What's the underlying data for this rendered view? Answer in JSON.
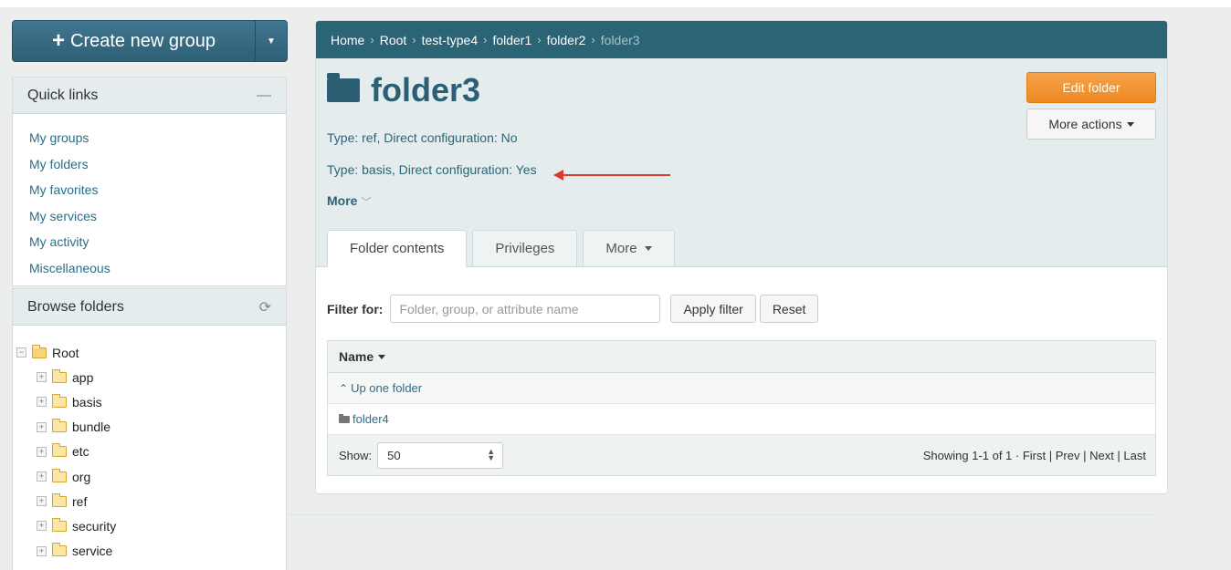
{
  "sidebar": {
    "create_button": {
      "label": "Create new group"
    },
    "quick_links": {
      "title": "Quick links",
      "items": [
        "My groups",
        "My folders",
        "My favorites",
        "My services",
        "My activity",
        "Miscellaneous"
      ]
    },
    "browse": {
      "title": "Browse folders",
      "root": "Root",
      "children": [
        "app",
        "basis",
        "bundle",
        "etc",
        "org",
        "ref",
        "security",
        "service"
      ]
    }
  },
  "breadcrumb": [
    "Home",
    "Root",
    "test-type4",
    "folder1",
    "folder2"
  ],
  "breadcrumb_current": "folder3",
  "folder": {
    "title": "folder3",
    "meta": [
      "Type: ref, Direct configuration: No",
      "Type: basis, Direct configuration: Yes"
    ],
    "more_label": "More"
  },
  "actions": {
    "edit": "Edit folder",
    "more_actions": "More actions"
  },
  "tabs": [
    {
      "label": "Folder contents"
    },
    {
      "label": "Privileges"
    },
    {
      "label": "More"
    }
  ],
  "filter": {
    "label": "Filter for:",
    "placeholder": "Folder, group, or attribute name",
    "apply": "Apply filter",
    "reset": "Reset"
  },
  "table": {
    "header": "Name",
    "rows": [
      "Up one folder",
      "folder4"
    ],
    "show_label": "Show:",
    "page_size": "50",
    "summary": "Showing 1-1 of 1 · ",
    "pager": [
      "First",
      "Prev",
      "Next",
      "Last"
    ]
  },
  "colors": {
    "accent": "#2b6475",
    "edit_button": "#ee8923",
    "annotation_arrow": "#d93b2b"
  }
}
